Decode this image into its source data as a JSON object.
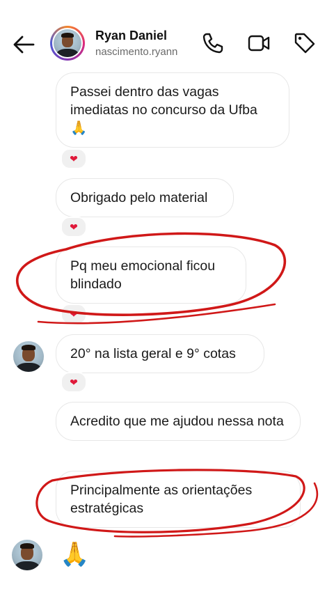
{
  "header": {
    "name": "Ryan Daniel",
    "username": "nascimento.ryann",
    "icons": [
      "back-arrow-icon",
      "phone-icon",
      "video-icon",
      "tag-icon"
    ]
  },
  "messages": [
    {
      "text": "Passei dentro das vagas imediatas no concurso da Ufba 🙏",
      "reaction": "❤"
    },
    {
      "text": "Obrigado pelo material",
      "reaction": "❤"
    },
    {
      "text": "Pq meu emocional ficou blindado",
      "reaction": "❤"
    },
    {
      "text": "20° na lista geral e 9° cotas",
      "reaction": "❤"
    },
    {
      "text": "Acredito que me ajudou nessa nota"
    },
    {
      "text": "Principalmente as orientações estratégicas"
    },
    {
      "text": "🙏"
    }
  ],
  "colors": {
    "annotation_red": "#d01818",
    "reaction_heart": "#e0193a",
    "bubble_border": "#e7e7e7"
  }
}
